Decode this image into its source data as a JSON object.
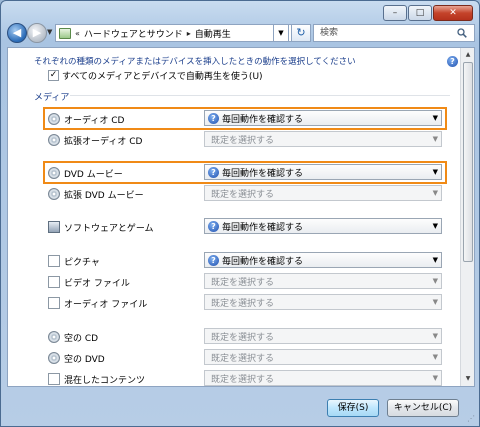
{
  "window": {
    "minimize": "–",
    "maximize": "□",
    "close": "✕"
  },
  "nav": {
    "back": "◀",
    "forward": "▶",
    "history_drop": "▼",
    "breadcrumb_prefix": "«",
    "breadcrumb_1": "ハードウェアとサウンド",
    "breadcrumb_sep": "▸",
    "breadcrumb_2": "自動再生",
    "address_drop": "▼",
    "refresh": "↻",
    "search_placeholder": "検索"
  },
  "header": {
    "intro": "それぞれの種類のメディアまたはデバイスを挿入したときの動作を選択してください",
    "help": "?",
    "global_checkbox_label": "すべてのメディアとデバイスで自動再生を使う(U)",
    "global_checkbox_checked": "✓",
    "section_label": "メディア"
  },
  "rows": [
    {
      "icon": "disc-icon",
      "label": "オーディオ CD",
      "value": "毎回動作を確認する",
      "enabled": true,
      "highlighted": true
    },
    {
      "icon": "disc-icon",
      "label": "拡張オーディオ CD",
      "value": "既定を選択する",
      "enabled": false,
      "highlighted": false
    },
    {
      "icon": "disc-icon",
      "label": "DVD ムービー",
      "value": "毎回動作を確認する",
      "enabled": true,
      "highlighted": true
    },
    {
      "icon": "disc-icon",
      "label": "拡張 DVD ムービー",
      "value": "既定を選択する",
      "enabled": false,
      "highlighted": false
    },
    {
      "icon": "software-icon",
      "label": "ソフトウェアとゲーム",
      "value": "毎回動作を確認する",
      "enabled": true,
      "highlighted": false
    },
    {
      "icon": "picture-icon",
      "label": "ピクチャ",
      "value": "毎回動作を確認する",
      "enabled": true,
      "highlighted": false
    },
    {
      "icon": "video-file-icon",
      "label": "ビデオ ファイル",
      "value": "既定を選択する",
      "enabled": false,
      "highlighted": false
    },
    {
      "icon": "audio-file-icon",
      "label": "オーディオ ファイル",
      "value": "既定を選択する",
      "enabled": false,
      "highlighted": false
    },
    {
      "icon": "disc-icon",
      "label": "空の CD",
      "value": "既定を選択する",
      "enabled": false,
      "highlighted": false
    },
    {
      "icon": "disc-icon",
      "label": "空の DVD",
      "value": "既定を選択する",
      "enabled": false,
      "highlighted": false
    },
    {
      "icon": "mixed-content-icon",
      "label": "混在したコンテンツ",
      "value": "既定を選択する",
      "enabled": false,
      "highlighted": false
    }
  ],
  "footer": {
    "save": "保存(S)",
    "cancel": "キャンセル(C)"
  },
  "colors": {
    "highlight": "#f08a16",
    "link_blue": "#1c3f8c"
  }
}
